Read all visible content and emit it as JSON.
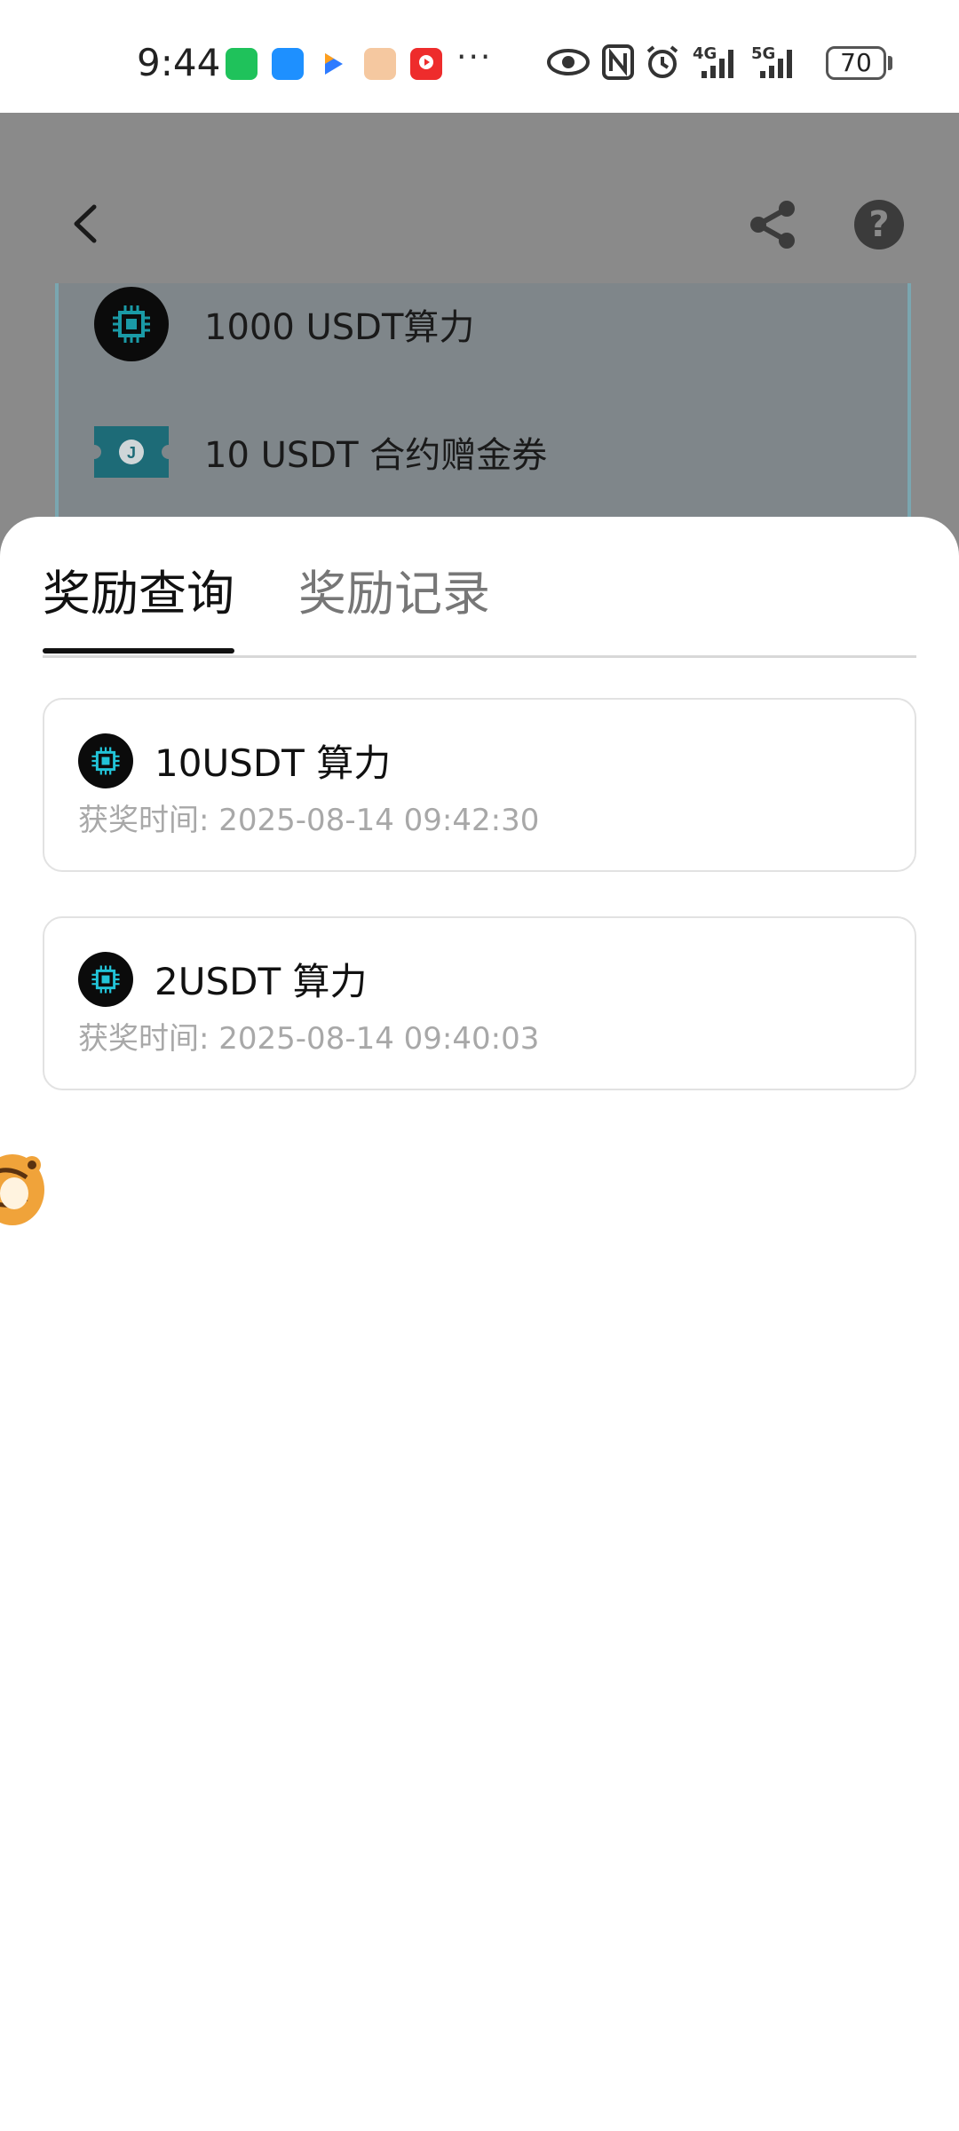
{
  "status_bar": {
    "time": "9:44",
    "battery": "70",
    "network_1": "4G",
    "network_2": "5G",
    "more": "···",
    "icons": [
      "wechat-icon",
      "message-icon",
      "arrow-app-icon",
      "game-app-icon",
      "video-app-icon",
      "eye-icon",
      "nfc-icon",
      "alarm-icon",
      "signal-icon",
      "signal-icon"
    ]
  },
  "header": {
    "icons": [
      "back-arrow-icon",
      "share-icon",
      "help-icon"
    ],
    "help_glyph": "?"
  },
  "rewards_preview": [
    {
      "label": "1000 USDT算力",
      "icon": "chip-icon"
    },
    {
      "label": "10 USDT 合约赠金券",
      "icon": "ticket-icon"
    }
  ],
  "sheet": {
    "tabs": [
      {
        "label": "奖励查询",
        "active": true
      },
      {
        "label": "奖励记录",
        "active": false
      }
    ],
    "records": [
      {
        "title": "10USDT 算力",
        "time": "获奖时间: 2025-08-14 09:42:30",
        "icon": "chip-icon"
      },
      {
        "title": "2USDT 算力",
        "time": "获奖时间: 2025-08-14 09:40:03",
        "icon": "chip-icon"
      }
    ]
  },
  "colors": {
    "overlay": "#8a8a8a",
    "accent_cyan": "#22c4d8",
    "text_primary": "#111111",
    "text_secondary": "#a8a8a8"
  }
}
